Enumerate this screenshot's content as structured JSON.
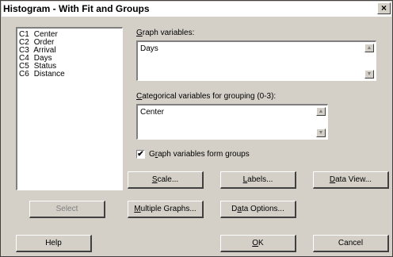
{
  "window": {
    "title": "Histogram - With Fit and Groups",
    "close_label": "×"
  },
  "variables": [
    {
      "col": "C1",
      "name": "Center"
    },
    {
      "col": "C2",
      "name": "Order"
    },
    {
      "col": "C3",
      "name": "Arrival"
    },
    {
      "col": "C4",
      "name": "Days"
    },
    {
      "col": "C5",
      "name": "Status"
    },
    {
      "col": "C6",
      "name": "Distance"
    }
  ],
  "graph_variables": {
    "label_u": "G",
    "label_rest": "raph variables:",
    "value": "Days"
  },
  "categorical": {
    "label_u": "C",
    "label_rest": "ategorical variables for grouping (0-3):",
    "value": "Center"
  },
  "form_groups": {
    "checked": true,
    "mark": "✔",
    "label_pre": "G",
    "label_u": "r",
    "label_rest": "aph variables form groups"
  },
  "buttons": {
    "scale": {
      "u": "S",
      "rest": "cale..."
    },
    "labels": {
      "u": "L",
      "rest": "abels..."
    },
    "data_view": {
      "u": "D",
      "rest": "ata View..."
    },
    "select": "Select",
    "multiple_graphs": {
      "u": "M",
      "rest": "ultiple Graphs..."
    },
    "data_options": {
      "pre": "D",
      "u": "a",
      "rest": "ta Options..."
    },
    "help": "Help",
    "ok": {
      "u": "O",
      "rest": "K"
    },
    "cancel": "Cancel"
  },
  "icons": {
    "scroll_up": "▲",
    "scroll_down": "▼"
  }
}
